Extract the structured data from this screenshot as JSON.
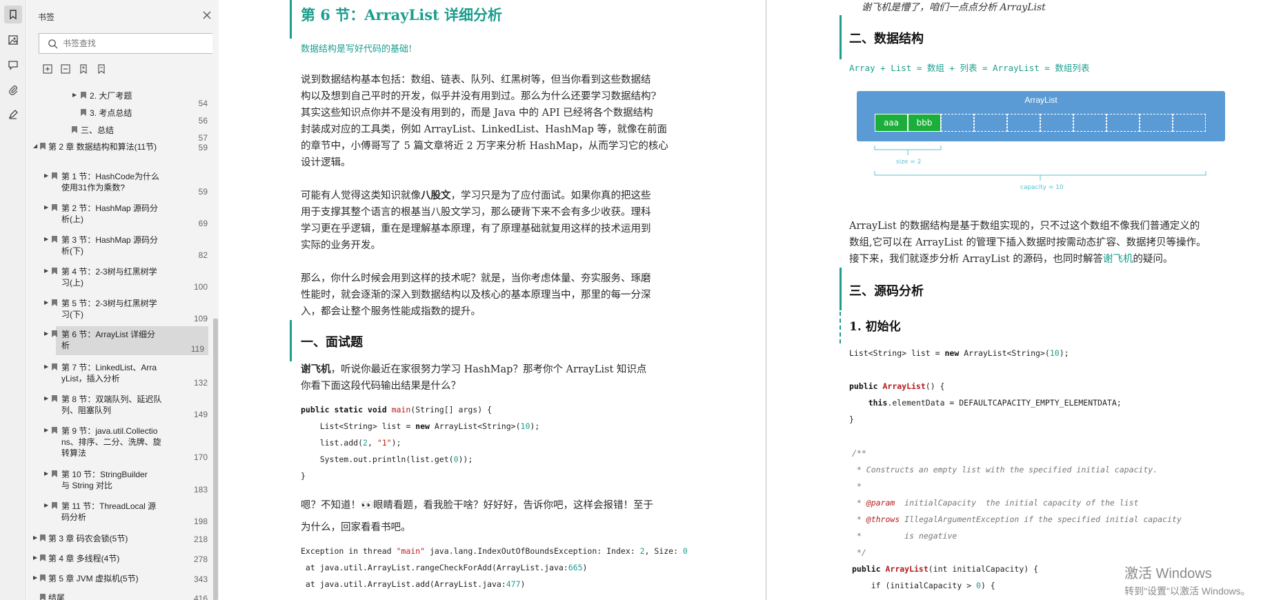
{
  "sidebar": {
    "title": "书签",
    "search_placeholder": "书签查找",
    "tree": [
      {
        "label": "2. 大厂考题",
        "page": "54",
        "arrow": true
      },
      {
        "label": "3. 考点总结",
        "page": "56",
        "arrow": false
      },
      {
        "label": "三、总结",
        "page": "57",
        "arrow": false
      },
      {
        "label": "第 2 章 数据结构和算法(11节)",
        "page": "59",
        "arrow": true
      },
      {
        "label1": "第 1 节：HashCode为什么",
        "label2": "使用31作为乘数?",
        "page": "59",
        "arrow": true
      },
      {
        "label1": "第 2 节：HashMap 源码分",
        "label2": "析(上)",
        "page": "69",
        "arrow": true
      },
      {
        "label1": "第 3 节：HashMap 源码分",
        "label2": "析(下)",
        "page": "82",
        "arrow": true
      },
      {
        "label1": "第 4 节：2-3树与红黑树学",
        "label2": "习(上)",
        "page": "100",
        "arrow": true
      },
      {
        "label1": "第 5 节：2-3树与红黑树学",
        "label2": "习(下)",
        "page": "109",
        "arrow": true
      },
      {
        "label1": "第 6 节：ArrayList 详细分",
        "label2": "析",
        "page": "119",
        "arrow": true
      },
      {
        "label1": "第 7 节：LinkedList、Arra",
        "label2": "yList，插入分析",
        "page": "132",
        "arrow": true
      },
      {
        "label1": "第 8 节：双端队列、延迟队",
        "label2": "列、阻塞队列",
        "page": "149",
        "arrow": true
      },
      {
        "label1": "第 9 节：java.util.Collectio",
        "label2": "ns、排序、二分、洗牌、旋",
        "label3": "转算法",
        "page": "170",
        "arrow": true
      },
      {
        "label1": "第 10 节：StringBuilder",
        "label2": "与 String 对比",
        "page": "183",
        "arrow": true
      },
      {
        "label1": "第 11 节：ThreadLocal 源",
        "label2": "码分析",
        "page": "198",
        "arrow": true
      },
      {
        "label": "第 3 章 码农会锁(5节)",
        "page": "218",
        "arrow": true
      },
      {
        "label": "第 4 章 多线程(4节)",
        "page": "278",
        "arrow": true
      },
      {
        "label": "第 5 章 JVM 虚拟机(5节)",
        "page": "343",
        "arrow": true
      },
      {
        "label": "结尾",
        "page": "416",
        "arrow": false
      }
    ]
  },
  "left_page": {
    "section_title": "第 6 节：ArrayList 详细分析",
    "lead": "数据结构是写好代码的基础!",
    "p1": [
      "说到数据结构基本包括：数组、链表、队列、红黑树等，但当你看到这些数据结",
      "构以及想到自己平时的开发，似乎并没有用到过。那么为什么还要学习数据结构?",
      "其实这些知识点你并不是没有用到的，而是 Java 中的 API 已经将各个数据结构",
      "封装成对应的工具类，例如 ArrayList、LinkedList、HashMap 等，就像在前面",
      "的章节中，小傅哥写了 5 篇文章将近 2 万字来分析 HashMap，从而学习它的核心",
      "设计逻辑。"
    ],
    "p2_line1_a": "可能有人觉得这类知识就像",
    "p2_line1_b": "八股文",
    "p2_line1_c": "，学习只是为了应付面试。如果你真的把这些",
    "p2_rest": [
      "用于支撑其整个语言的根基当八股文学习，那么硬背下来不会有多少收获。理科",
      "学习更在乎逻辑，重在是理解基本原理，有了原理基础就复用这样的技术运用到",
      "实际的业务开发。"
    ],
    "p3": [
      "那么，你什么时候会用到这样的技术呢？就是，当你考虑体量、夯实服务、琢磨",
      "性能时，就会逐渐的深入到数据结构以及核心的基本原理当中，那里的每一分深",
      "入，都会让整个服务性能成指数的提升。"
    ],
    "h_interview": "一、面试题",
    "q_name": "谢飞机",
    "q_line1": "，听说你最近在家很努力学习 HashMap？那考你个 ArrayList 知识点",
    "q_line2": "你看下面这段代码输出结果是什么？",
    "code1": {
      "l1_mod": "public static void ",
      "l1_fn": "main",
      "l1_rest": "(String[] args) {",
      "l2_a": "    List<String> list = ",
      "l2_new": "new",
      "l2_b": " ArrayList<String>(",
      "l2_num": "10",
      "l2_c": ");",
      "l3_a": "    list.add(",
      "l3_num": "2",
      "l3_b": ", ",
      "l3_str": "\"1\"",
      "l3_c": ");",
      "l4_a": "    System.out.println(list.get(",
      "l4_num": "0",
      "l4_b": "));",
      "l5": "}"
    },
    "answer_line1": "嗯？不知道！👀眼睛看题，看我脸干啥？好好好，告诉你吧，这样会报错！至于",
    "answer_line2": "为什么，回家看看书吧。",
    "exc": {
      "l1_a": "Exception in thread ",
      "l1_str": "\"main\"",
      "l1_b": " java.lang.IndexOutOfBoundsException: Index: ",
      "l1_n1": "2",
      "l1_c": ", Size: ",
      "l1_n2": "0",
      "l2_a": " at java.util.ArrayList.rangeCheckForAdd(ArrayList.java:",
      "l2_n": "665",
      "l2_b": ")",
      "l3_a": " at java.util.ArrayList.add(ArrayList.java:",
      "l3_n": "477",
      "l3_b": ")"
    }
  },
  "right_page": {
    "top_line": "谢飞机是懵了，咱们一点点分析 ArrayList",
    "h_structure": "二、数据结构",
    "formula": "Array + List = 数组 + 列表 = ArrayList = 数组列表",
    "diagram": {
      "title": "ArrayList",
      "cell1": "aaa",
      "cell2": "bbb",
      "size_label": "size = 2",
      "capacity_label": "capacity = 10",
      "header_color": "#5b9bd5",
      "cell_color": "#1bae3a"
    },
    "desc": [
      "ArrayList 的数据结构是基于数组实现的，只不过这个数组不像我们普通定义的",
      "数组,它可以在 ArrayList 的管理下插入数据时按需动态扩容、数据拷贝等操作。"
    ],
    "desc3_a": "接下来，我们就逐步分析 ArrayList 的源码，也同时解答",
    "desc3_link": "谢飞机",
    "desc3_b": "的疑问。",
    "h_source": "三、源码分析",
    "h_init": "1.  初始化",
    "code2": {
      "l1_a": "List<String> list = ",
      "l1_new": "new",
      "l1_b": " ArrayList<String>(",
      "l1_num": "10",
      "l1_c": ");",
      "l2_pub": "public ",
      "l2_fn": "ArrayList",
      "l2_rest": "() {",
      "l3_a": "    ",
      "l3_this": "this",
      "l3_b": ".elementData = DEFAULTCAPACITY_EMPTY_ELEMENTDATA;",
      "l4": "}"
    },
    "javadoc": {
      "l1": "/**",
      "l2": " * Constructs an empty list with the specified initial capacity.",
      "l3": " *",
      "l4_a": " * ",
      "l4_tag": "@param",
      "l4_b": "  initialCapacity  the initial capacity of the list",
      "l5_a": " * ",
      "l5_tag": "@throws",
      "l5_b": " IllegalArgumentException if the specified initial capacity",
      "l6": " *         is negative",
      "l7": " */"
    },
    "code3": {
      "l1_pub": "public ",
      "l1_fn": "ArrayList",
      "l1_rest": "(int initialCapacity) {",
      "l2_a": "    if (initialCapacity > ",
      "l2_num": "0",
      "l2_b": ") {"
    }
  },
  "watermark": {
    "line1": "激活 Windows",
    "line2": "转到\"设置\"以激活 Windows。"
  }
}
